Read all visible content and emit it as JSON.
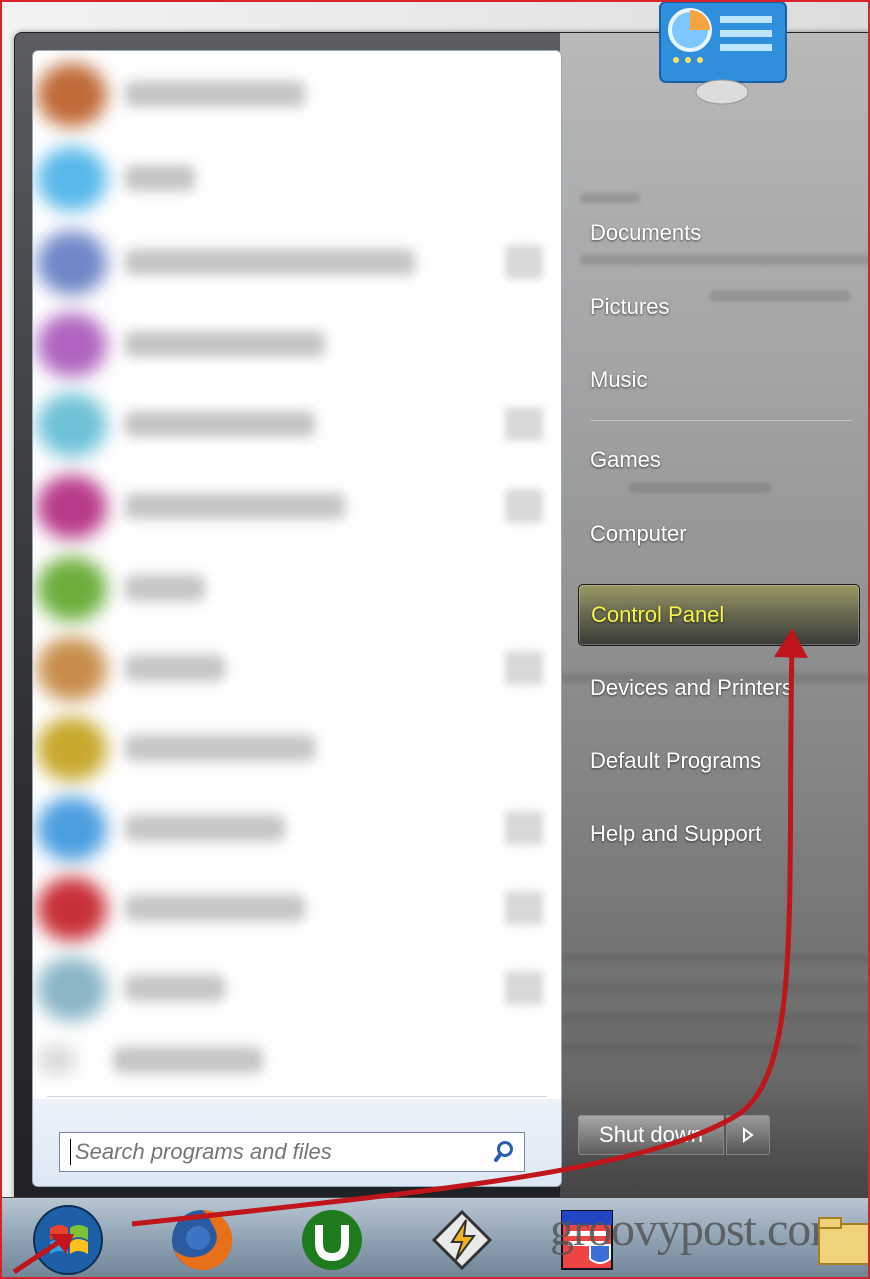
{
  "start_menu": {
    "right_items": [
      {
        "label": "Documents"
      },
      {
        "label": "Pictures"
      },
      {
        "label": "Music"
      },
      {
        "label": "Games"
      },
      {
        "label": "Computer"
      },
      {
        "label": "Control Panel"
      },
      {
        "label": "Devices and Printers"
      },
      {
        "label": "Default Programs"
      },
      {
        "label": "Help and Support"
      }
    ],
    "highlighted_item": "Control Panel",
    "search": {
      "placeholder": "Search programs and files"
    },
    "shutdown_label": "Shut down"
  },
  "taskbar": {
    "items": [
      "start-orb-icon",
      "firefox-icon",
      "utorrent-icon",
      "winamp-icon",
      "windows-security-icon",
      "folder-icon"
    ],
    "watermark": "groovypost.com"
  },
  "colors": {
    "highlight_text": "#f7f44a",
    "annotation_arrow": "#c0151b",
    "frame_border": "#d9232a"
  }
}
